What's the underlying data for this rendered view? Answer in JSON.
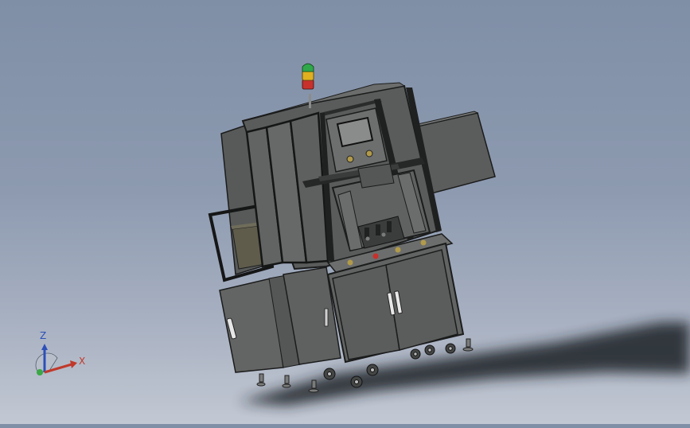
{
  "viewport": {
    "background_top": "#7f8fa6",
    "background_bottom": "#c2c8d3",
    "model_color": "#5b5d5c",
    "edge_color": "#1b1c1c",
    "panel_color": "#6a6c6a",
    "drawer_color": "#5f5c4c",
    "signal_light": {
      "top": "#2fa84a",
      "middle": "#e0b020",
      "bottom": "#c8302c"
    }
  },
  "triad": {
    "x_label": "X",
    "y_label": "",
    "z_label": "Z",
    "x_color": "#c0392b",
    "z_color": "#2d4fb8",
    "y_color": "#3aa845"
  }
}
